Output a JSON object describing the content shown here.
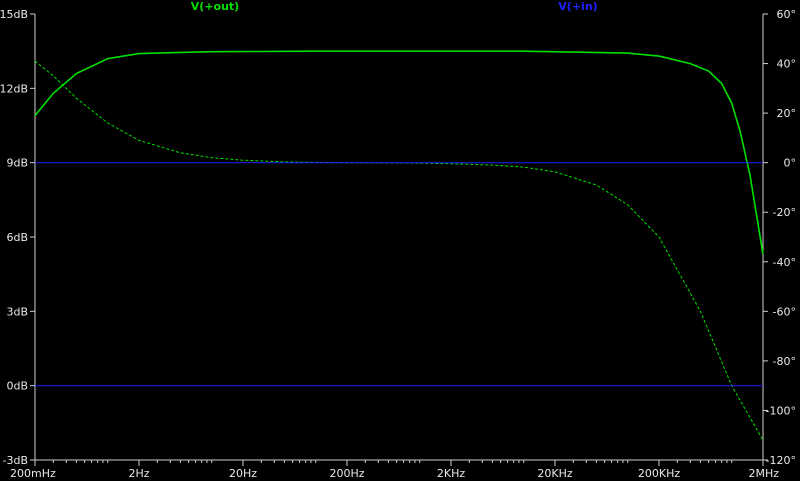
{
  "chart_data": {
    "type": "line",
    "title": "",
    "x_scale": "log",
    "x_range_hz": [
      0.2,
      2000000
    ],
    "x_ticks": [
      {
        "value": 0.2,
        "label": "200mHz"
      },
      {
        "value": 2,
        "label": "2Hz"
      },
      {
        "value": 20,
        "label": "20Hz"
      },
      {
        "value": 200,
        "label": "200Hz"
      },
      {
        "value": 2000,
        "label": "2KHz"
      },
      {
        "value": 20000,
        "label": "20KHz"
      },
      {
        "value": 200000,
        "label": "200KHz"
      },
      {
        "value": 2000000,
        "label": "2MHz"
      }
    ],
    "y_left": {
      "range": [
        -3,
        15
      ],
      "ticks": [
        {
          "value": 15,
          "label": "15dB"
        },
        {
          "value": 12,
          "label": "12dB"
        },
        {
          "value": 9,
          "label": "9dB"
        },
        {
          "value": 6,
          "label": "6dB"
        },
        {
          "value": 3,
          "label": "3dB"
        },
        {
          "value": 0,
          "label": "0dB"
        },
        {
          "value": -3,
          "label": "-3dB"
        }
      ]
    },
    "y_right": {
      "range": [
        -120,
        60
      ],
      "ticks": [
        {
          "value": 60,
          "label": "60°"
        },
        {
          "value": 40,
          "label": "40°"
        },
        {
          "value": 20,
          "label": "20°"
        },
        {
          "value": 0,
          "label": "0°"
        },
        {
          "value": -20,
          "label": "-20°"
        },
        {
          "value": -40,
          "label": "-40°"
        },
        {
          "value": -60,
          "label": "-60°"
        },
        {
          "value": -80,
          "label": "-80°"
        },
        {
          "value": -100,
          "label": "-100°"
        },
        {
          "value": -120,
          "label": "-120°"
        }
      ]
    },
    "grid": false,
    "legend": [
      {
        "label": "V(+out)",
        "color": "#00e000"
      },
      {
        "label": "V(+in)",
        "color": "#2020ff"
      }
    ],
    "series": [
      {
        "name": "V(+out)",
        "quantity": "magnitude",
        "axis": "left",
        "color": "#00e000",
        "style": "solid",
        "x": [
          0.2,
          0.3,
          0.5,
          1,
          2,
          5,
          10,
          100,
          1000,
          10000,
          100000,
          200000,
          400000,
          600000,
          800000,
          1000000,
          1200000,
          1500000,
          2000000
        ],
        "y": [
          10.9,
          11.8,
          12.6,
          13.2,
          13.4,
          13.45,
          13.48,
          13.5,
          13.5,
          13.5,
          13.42,
          13.3,
          13.0,
          12.7,
          12.2,
          11.4,
          10.3,
          8.5,
          5.3
        ]
      },
      {
        "name": "V(+out)",
        "quantity": "phase",
        "axis": "right",
        "color": "#00e000",
        "style": "dashed",
        "x": [
          0.2,
          0.3,
          0.5,
          1,
          2,
          5,
          10,
          20,
          50,
          100,
          200,
          500,
          1000,
          2000,
          5000,
          10000,
          20000,
          50000,
          100000,
          200000,
          500000,
          1000000,
          2000000
        ],
        "y": [
          41,
          35,
          26,
          16,
          9,
          4,
          2,
          1,
          0.3,
          0.1,
          0,
          -0.1,
          -0.2,
          -0.4,
          -1,
          -1.8,
          -3.7,
          -9,
          -17,
          -30,
          -60,
          -90,
          -112
        ]
      },
      {
        "name": "V(+in)",
        "quantity": "magnitude",
        "axis": "left",
        "color": "#2020ff",
        "style": "solid",
        "x": [
          0.2,
          2000000
        ],
        "y": [
          0,
          0
        ]
      },
      {
        "name": "V(+in)",
        "quantity": "phase",
        "axis": "right",
        "color": "#2020ff",
        "style": "solid",
        "x": [
          0.2,
          2000000
        ],
        "y": [
          0,
          0
        ]
      }
    ]
  }
}
